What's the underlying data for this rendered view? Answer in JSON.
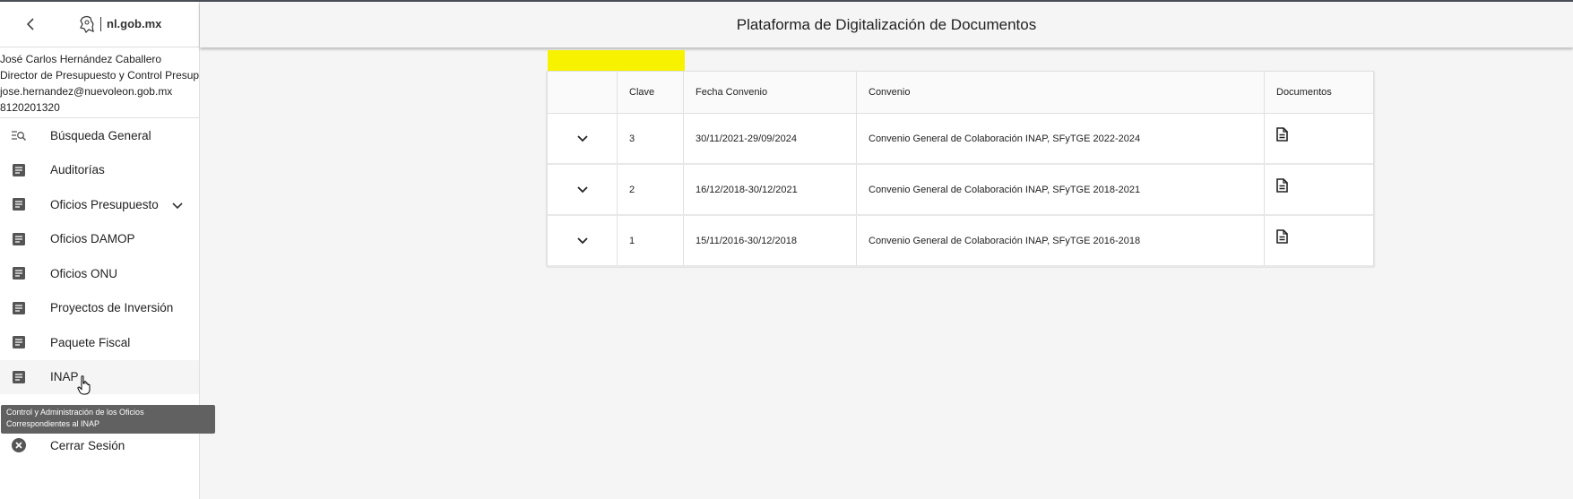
{
  "brand": {
    "logo_text": "nl.gob.mx",
    "logo_icon": "nuevo-leon-emblem-icon"
  },
  "user": {
    "name": "José Carlos Hernández Caballero",
    "role": "Director de Presupuesto y Control Presupuestal",
    "email": "jose.hernandez@nuevoleon.gob.mx",
    "phone": "8120201320"
  },
  "nav": {
    "items": [
      {
        "label": "Búsqueda General",
        "icon": "search-list-icon"
      },
      {
        "label": "Auditorías",
        "icon": "document-icon"
      },
      {
        "label": "Oficios Presupuesto",
        "icon": "document-icon",
        "has_submenu": true
      },
      {
        "label": "Oficios DAMOP",
        "icon": "document-icon"
      },
      {
        "label": "Oficios ONU",
        "icon": "document-icon"
      },
      {
        "label": "Proyectos de Inversión",
        "icon": "document-icon"
      },
      {
        "label": "Paquete Fiscal",
        "icon": "document-icon"
      },
      {
        "label": "INAP",
        "icon": "document-icon",
        "hovered": true
      },
      {
        "label": "Cerrar Sesión",
        "icon": "close-circle-icon"
      }
    ],
    "tooltip": "Control y Administración de los Oficios Correspondientes al INAP"
  },
  "header": {
    "title": "Plataforma de Digitalización de Documentos"
  },
  "table": {
    "columns": [
      "",
      "Clave",
      "Fecha Convenio",
      "Convenio",
      "Documentos"
    ],
    "rows": [
      {
        "clave": "3",
        "fecha": "30/11/2021-29/09/2024",
        "convenio": "Convenio General de Colaboración INAP, SFyTGE 2022-2024"
      },
      {
        "clave": "2",
        "fecha": "16/12/2018-30/12/2021",
        "convenio": "Convenio General de Colaboración INAP, SFyTGE 2018-2021"
      },
      {
        "clave": "1",
        "fecha": "15/11/2016-30/12/2018",
        "convenio": "Convenio General de Colaboración INAP, SFyTGE 2016-2018"
      }
    ]
  },
  "colors": {
    "highlight": "#f7f300",
    "icon": "#555555",
    "tooltip_bg": "#616161"
  }
}
